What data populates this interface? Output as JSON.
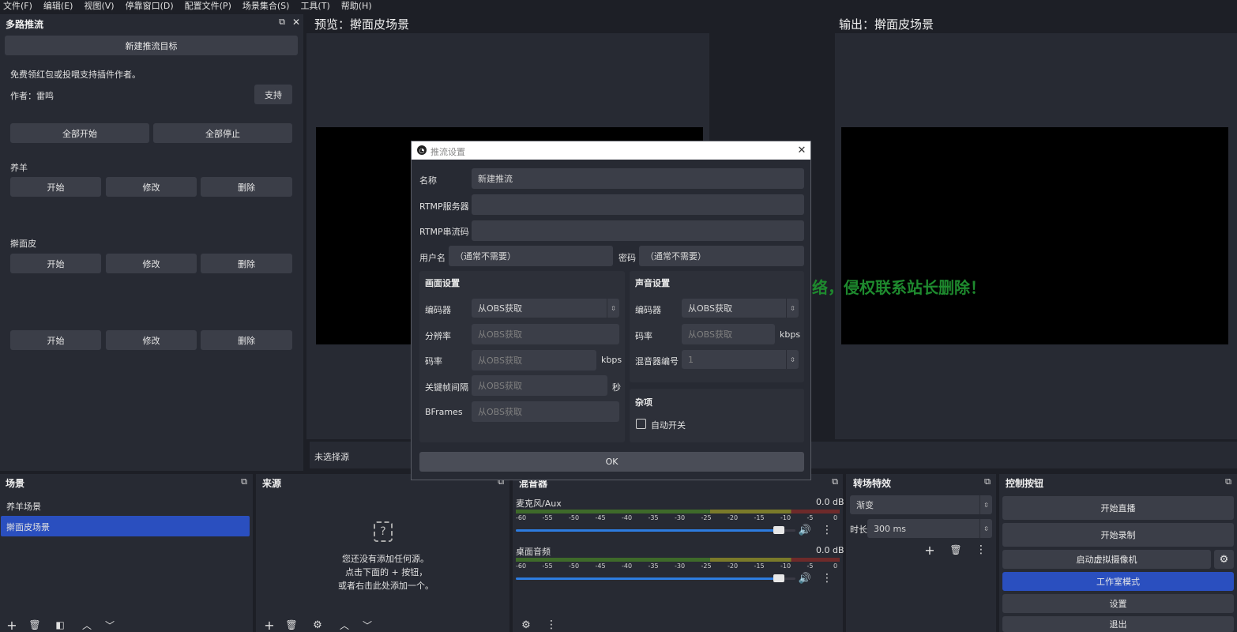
{
  "menu": [
    "文件(F)",
    "编辑(E)",
    "视图(V)",
    "停靠窗口(D)",
    "配置文件(P)",
    "场景集合(S)",
    "工具(T)",
    "帮助(H)"
  ],
  "multistream": {
    "title": "多路推流",
    "new_target": "新建推流目标",
    "donate_text": "免费领红包或投喂支持插件作者。",
    "author": "作者：雷鸣",
    "support": "支持",
    "start_all": "全部开始",
    "stop_all": "全部停止",
    "targets": [
      {
        "name": "养羊",
        "start": "开始",
        "edit": "修改",
        "delete": "删除"
      },
      {
        "name": "擀面皮",
        "start": "开始",
        "edit": "修改",
        "delete": "删除"
      },
      {
        "name": "",
        "start": "开始",
        "edit": "修改",
        "delete": "删除"
      }
    ]
  },
  "preview": {
    "title": "预览：擀面皮场景"
  },
  "output": {
    "title": "输出：擀面皮场景"
  },
  "no_source": "未选择源",
  "watermark": "图片来源于网络，侵权联系站长删除！",
  "scenes": {
    "title": "场景",
    "items": [
      "养羊场景",
      "擀面皮场景"
    ],
    "selected": 1
  },
  "sources": {
    "title": "来源",
    "empty_lines": [
      "您还没有添加任何源。",
      "点击下面的 + 按钮，",
      "或者右击此处添加一个。"
    ]
  },
  "mixer": {
    "title": "混音器",
    "channels": [
      {
        "name": "麦克风/Aux",
        "db": "0.0 dB",
        "level": 0.94
      },
      {
        "name": "桌面音频",
        "db": "0.0 dB",
        "level": 0.94
      }
    ],
    "ticks": [
      "-60",
      "-55",
      "-50",
      "-45",
      "-40",
      "-35",
      "-30",
      "-25",
      "-20",
      "-15",
      "-10",
      "-5",
      "0"
    ]
  },
  "transitions": {
    "title": "转场特效",
    "selected": "渐变",
    "duration_label": "时长",
    "duration_value": "300 ms"
  },
  "controls": {
    "title": "控制按钮",
    "start_stream": "开始直播",
    "start_record": "开始录制",
    "virtual_cam": "启动虚拟摄像机",
    "studio_mode": "工作室模式",
    "settings": "设置",
    "exit": "退出"
  },
  "dialog": {
    "title": "推流设置",
    "name_label": "名称",
    "name_value": "新建推流",
    "rtmp_server_label": "RTMP服务器",
    "rtmp_server_value": "",
    "rtmp_key_label": "RTMP串流码",
    "rtmp_key_value": "",
    "user_label": "用户名",
    "user_value": "（通常不需要）",
    "pass_label": "密码",
    "pass_value": "（通常不需要）",
    "video": {
      "title": "画面设置",
      "encoder_label": "编码器",
      "encoder_value": "从OBS获取",
      "resolution_label": "分辨率",
      "resolution_value": "从OBS获取",
      "bitrate_label": "码率",
      "bitrate_value": "从OBS获取",
      "bitrate_unit": "kbps",
      "keyframe_label": "关键帧间隔",
      "keyframe_value": "从OBS获取",
      "keyframe_unit": "秒",
      "bframes_label": "BFrames",
      "bframes_value": "从OBS获取"
    },
    "audio": {
      "title": "声音设置",
      "encoder_label": "编码器",
      "encoder_value": "从OBS获取",
      "bitrate_label": "码率",
      "bitrate_value": "从OBS获取",
      "bitrate_unit": "kbps",
      "mixer_label": "混音器编号",
      "mixer_value": "1"
    },
    "misc": {
      "title": "杂项",
      "auto_label": "自动开关"
    },
    "ok": "OK"
  }
}
